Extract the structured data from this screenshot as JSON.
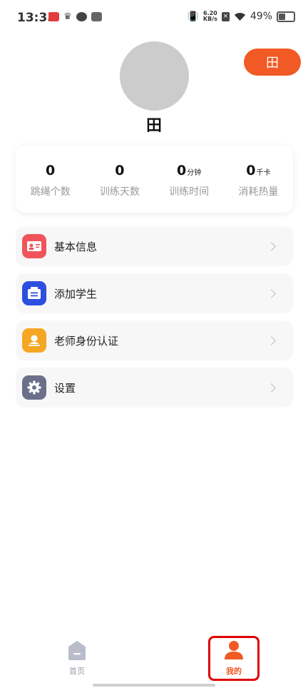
{
  "status_bar": {
    "time": "13:35",
    "net_speed_value": "6.20",
    "net_speed_unit": "KB/s",
    "battery_percent": "49%"
  },
  "profile": {
    "username": "田",
    "scan_button_icon": "田"
  },
  "stats": [
    {
      "value": "0",
      "unit": "",
      "label": "跳绳个数"
    },
    {
      "value": "0",
      "unit": "",
      "label": "训练天数"
    },
    {
      "value": "0",
      "unit": "分钟",
      "label": "训练时间"
    },
    {
      "value": "0",
      "unit": "千卡",
      "label": "消耗热量"
    }
  ],
  "menu": [
    {
      "label": "基本信息",
      "icon": "id-card-icon",
      "color": "#f0545a"
    },
    {
      "label": "添加学生",
      "icon": "add-student-icon",
      "color": "#2d4fe0"
    },
    {
      "label": "老师身份认证",
      "icon": "teacher-verify-icon",
      "color": "#f5a623"
    },
    {
      "label": "设置",
      "icon": "gear-icon",
      "color": "#6b7089"
    }
  ],
  "tabs": [
    {
      "label": "首页",
      "icon": "home-icon",
      "active": false
    },
    {
      "label": "我的",
      "icon": "user-icon",
      "active": true
    }
  ],
  "colors": {
    "accent": "#f15a24",
    "tab_inactive": "#9a9aa8",
    "highlight_box": "#e00000"
  }
}
